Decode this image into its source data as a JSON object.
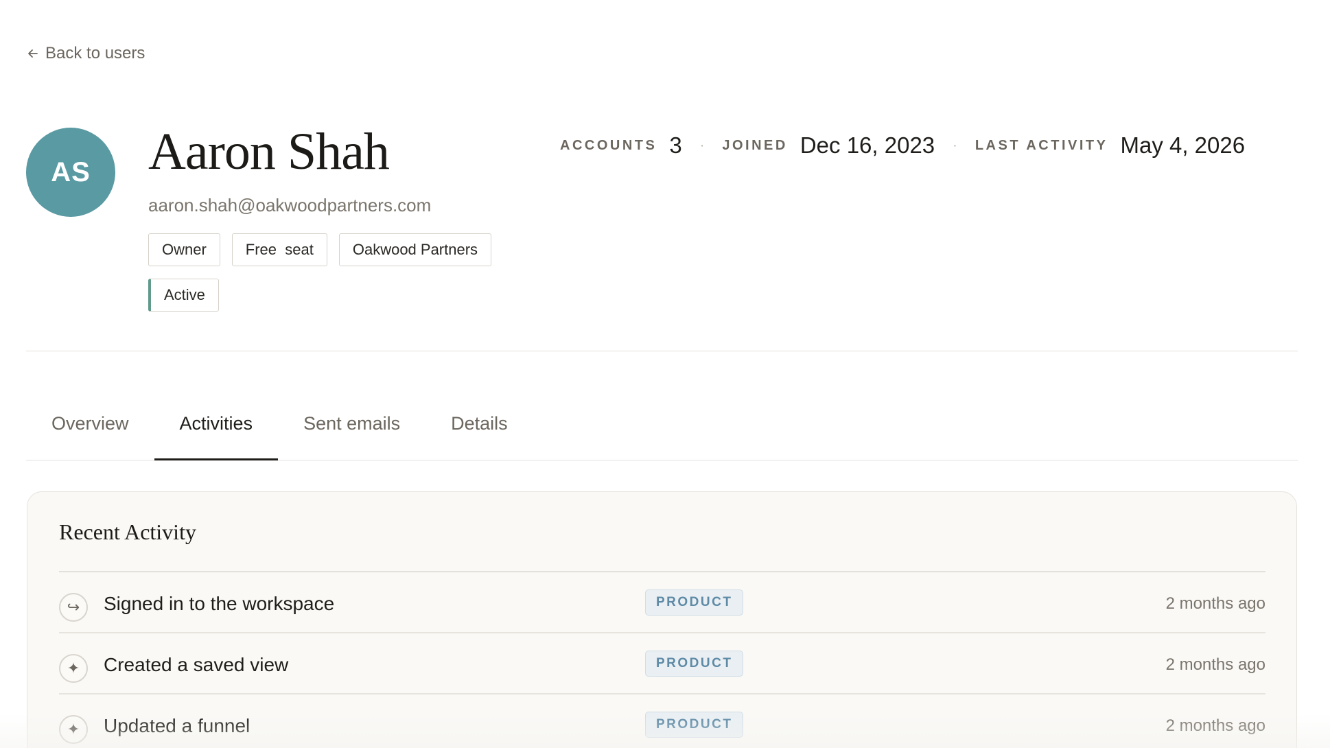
{
  "nav": {
    "back_label": "Back to users"
  },
  "user": {
    "initials": "AS",
    "name": "Aaron Shah",
    "email": "aaron.shah@oakwoodpartners.com",
    "badges": [
      "Owner",
      "Free  seat",
      "Oakwood Partners"
    ],
    "status": "Active",
    "avatar_color": "#5a9aa3"
  },
  "stats": [
    {
      "label": "ACCOUNTS",
      "value": "3"
    },
    {
      "label": "JOINED",
      "value": "Dec 16, 2023"
    },
    {
      "label": "LAST ACTIVITY",
      "value": "May 4, 2026"
    }
  ],
  "tabs": [
    {
      "label": "Overview",
      "active": false
    },
    {
      "label": "Activities",
      "active": true
    },
    {
      "label": "Sent emails",
      "active": false
    },
    {
      "label": "Details",
      "active": false
    }
  ],
  "recent_activity": {
    "title": "Recent Activity",
    "items": [
      {
        "icon": "sign-in-icon",
        "glyph": "↪",
        "title": "Signed in to the workspace",
        "tag": "PRODUCT",
        "time": "2 months ago"
      },
      {
        "icon": "sparkle-icon",
        "glyph": "✦",
        "title": "Created a saved view",
        "tag": "PRODUCT",
        "time": "2 months ago"
      },
      {
        "icon": "sparkle-icon",
        "glyph": "✦",
        "title": "Updated a funnel",
        "tag": "PRODUCT",
        "time": "2 months ago"
      }
    ]
  },
  "colors": {
    "accent_status": "#5f9a8b",
    "tag_text": "#5e8aa6",
    "tag_bg": "#e9eff3"
  }
}
